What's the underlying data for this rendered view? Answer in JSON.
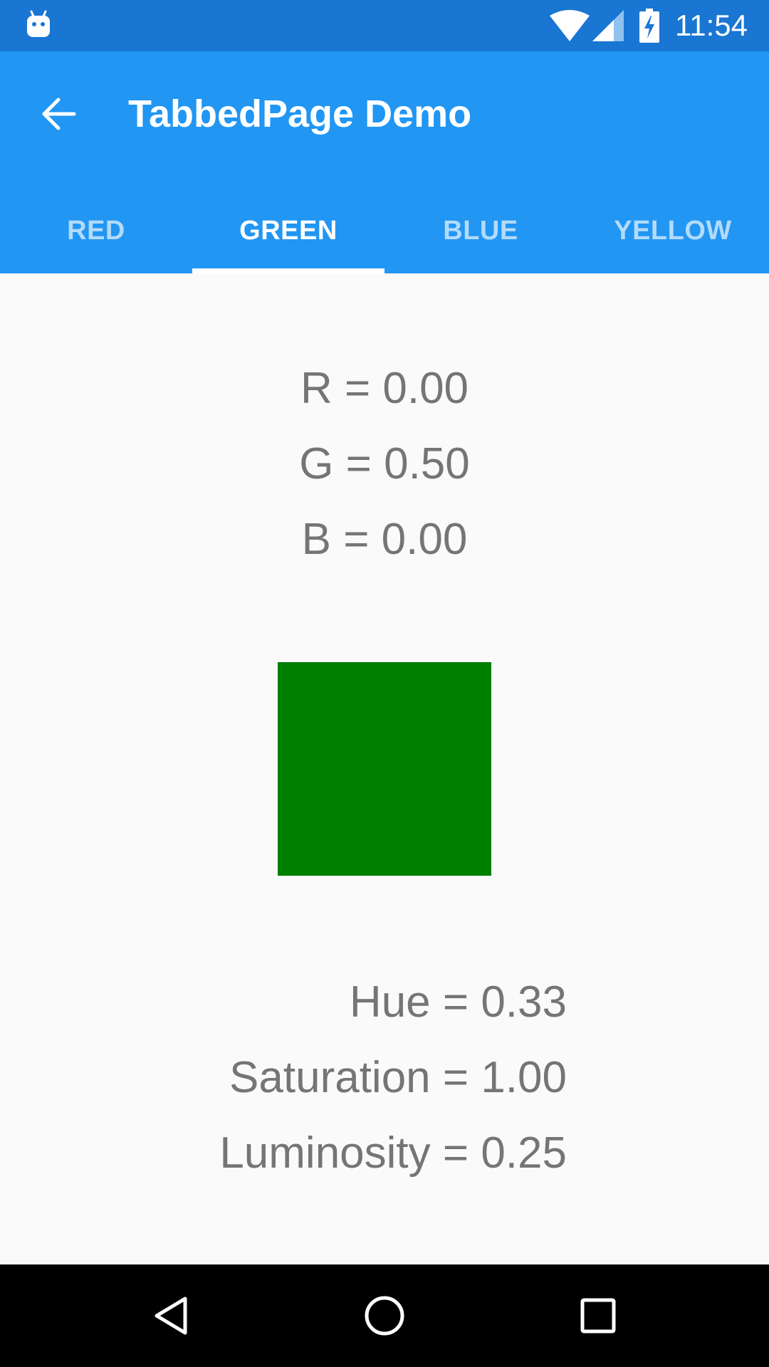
{
  "status_bar": {
    "time": "11:54",
    "icons": [
      "android-icon",
      "wifi-icon",
      "signal-icon",
      "battery-charging-icon"
    ]
  },
  "app_bar": {
    "title": "TabbedPage Demo",
    "back_icon": "arrow-back-icon"
  },
  "tabs": [
    {
      "label": "RED",
      "active": false
    },
    {
      "label": "GREEN",
      "active": true
    },
    {
      "label": "BLUE",
      "active": false
    },
    {
      "label": "YELLOW",
      "active": false
    }
  ],
  "content": {
    "rgb": {
      "r": "R = 0.00",
      "g": "G = 0.50",
      "b": "B = 0.00"
    },
    "swatch_color": "#008000",
    "hsl": {
      "hue": "Hue = 0.33",
      "saturation": "Saturation = 1.00",
      "luminosity": "Luminosity = 0.25"
    }
  },
  "nav_bar": {
    "icons": [
      "back-triangle-icon",
      "home-circle-icon",
      "recents-square-icon"
    ]
  },
  "colors": {
    "status_bar": "#1976d2",
    "app_bar": "#2196f3",
    "tab_inactive_text": "#b3dbfc",
    "tab_active_text": "#ffffff",
    "content_text": "#757575",
    "background": "#fafafa"
  }
}
